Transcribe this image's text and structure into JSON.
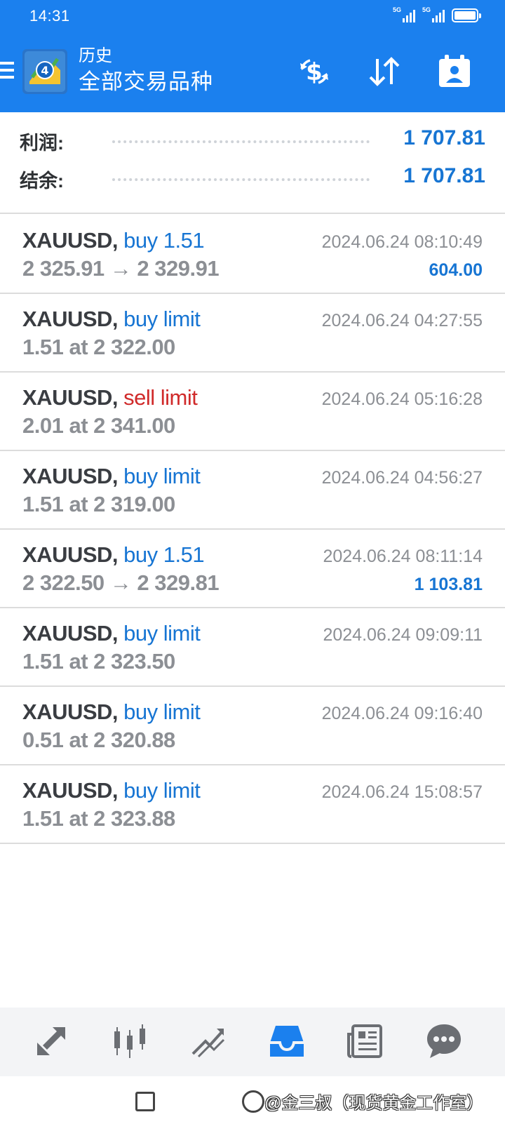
{
  "status_bar": {
    "time": "14:31",
    "signal1_label": "5G",
    "signal2_label": "5G"
  },
  "header": {
    "title": "历史",
    "subtitle": "全部交易品种",
    "icons": [
      "deposit-withdraw-icon",
      "sort-icon",
      "calendar-icon"
    ]
  },
  "summary": {
    "profit_label": "利润:",
    "profit_value": "1 707.81",
    "balance_label": "结余:",
    "balance_value": "1 707.81"
  },
  "orders": [
    {
      "symbol": "XAUUSD,",
      "type": "buy 1.51",
      "detail": "2 325.91 → 2 329.91",
      "time": "2024.06.24 08:10:49",
      "profit": "604.00"
    },
    {
      "symbol": "XAUUSD,",
      "type": "buy limit",
      "detail": "1.51 at 2 322.00",
      "time": "2024.06.24 04:27:55",
      "profit": ""
    },
    {
      "symbol": "XAUUSD,",
      "type": "sell limit",
      "detail": "2.01 at 2 341.00",
      "time": "2024.06.24 05:16:28",
      "profit": ""
    },
    {
      "symbol": "XAUUSD,",
      "type": "buy limit",
      "detail": "1.51 at 2 319.00",
      "time": "2024.06.24 04:56:27",
      "profit": ""
    },
    {
      "symbol": "XAUUSD,",
      "type": "buy 1.51",
      "detail": "2 322.50 → 2 329.81",
      "time": "2024.06.24 08:11:14",
      "profit": "1 103.81"
    },
    {
      "symbol": "XAUUSD,",
      "type": "buy limit",
      "detail": "1.51 at 2 323.50",
      "time": "2024.06.24 09:09:11",
      "profit": ""
    },
    {
      "symbol": "XAUUSD,",
      "type": "buy limit",
      "detail": "0.51 at 2 320.88",
      "time": "2024.06.24 09:16:40",
      "profit": ""
    },
    {
      "symbol": "XAUUSD,",
      "type": "buy limit",
      "detail": "1.51 at 2 323.88",
      "time": "2024.06.24 15:08:57",
      "profit": ""
    }
  ],
  "bottom_nav": {
    "items": [
      "quotes-icon",
      "chart-icon",
      "trade-icon",
      "history-icon",
      "news-icon",
      "chat-icon"
    ],
    "active": "history-icon"
  },
  "watermark": "@金三叔（现货黄金工作室）",
  "colors": {
    "primary": "#1b80ee",
    "buy": "#1775d3",
    "sell": "#d02a2a",
    "muted": "#8c8f94"
  }
}
